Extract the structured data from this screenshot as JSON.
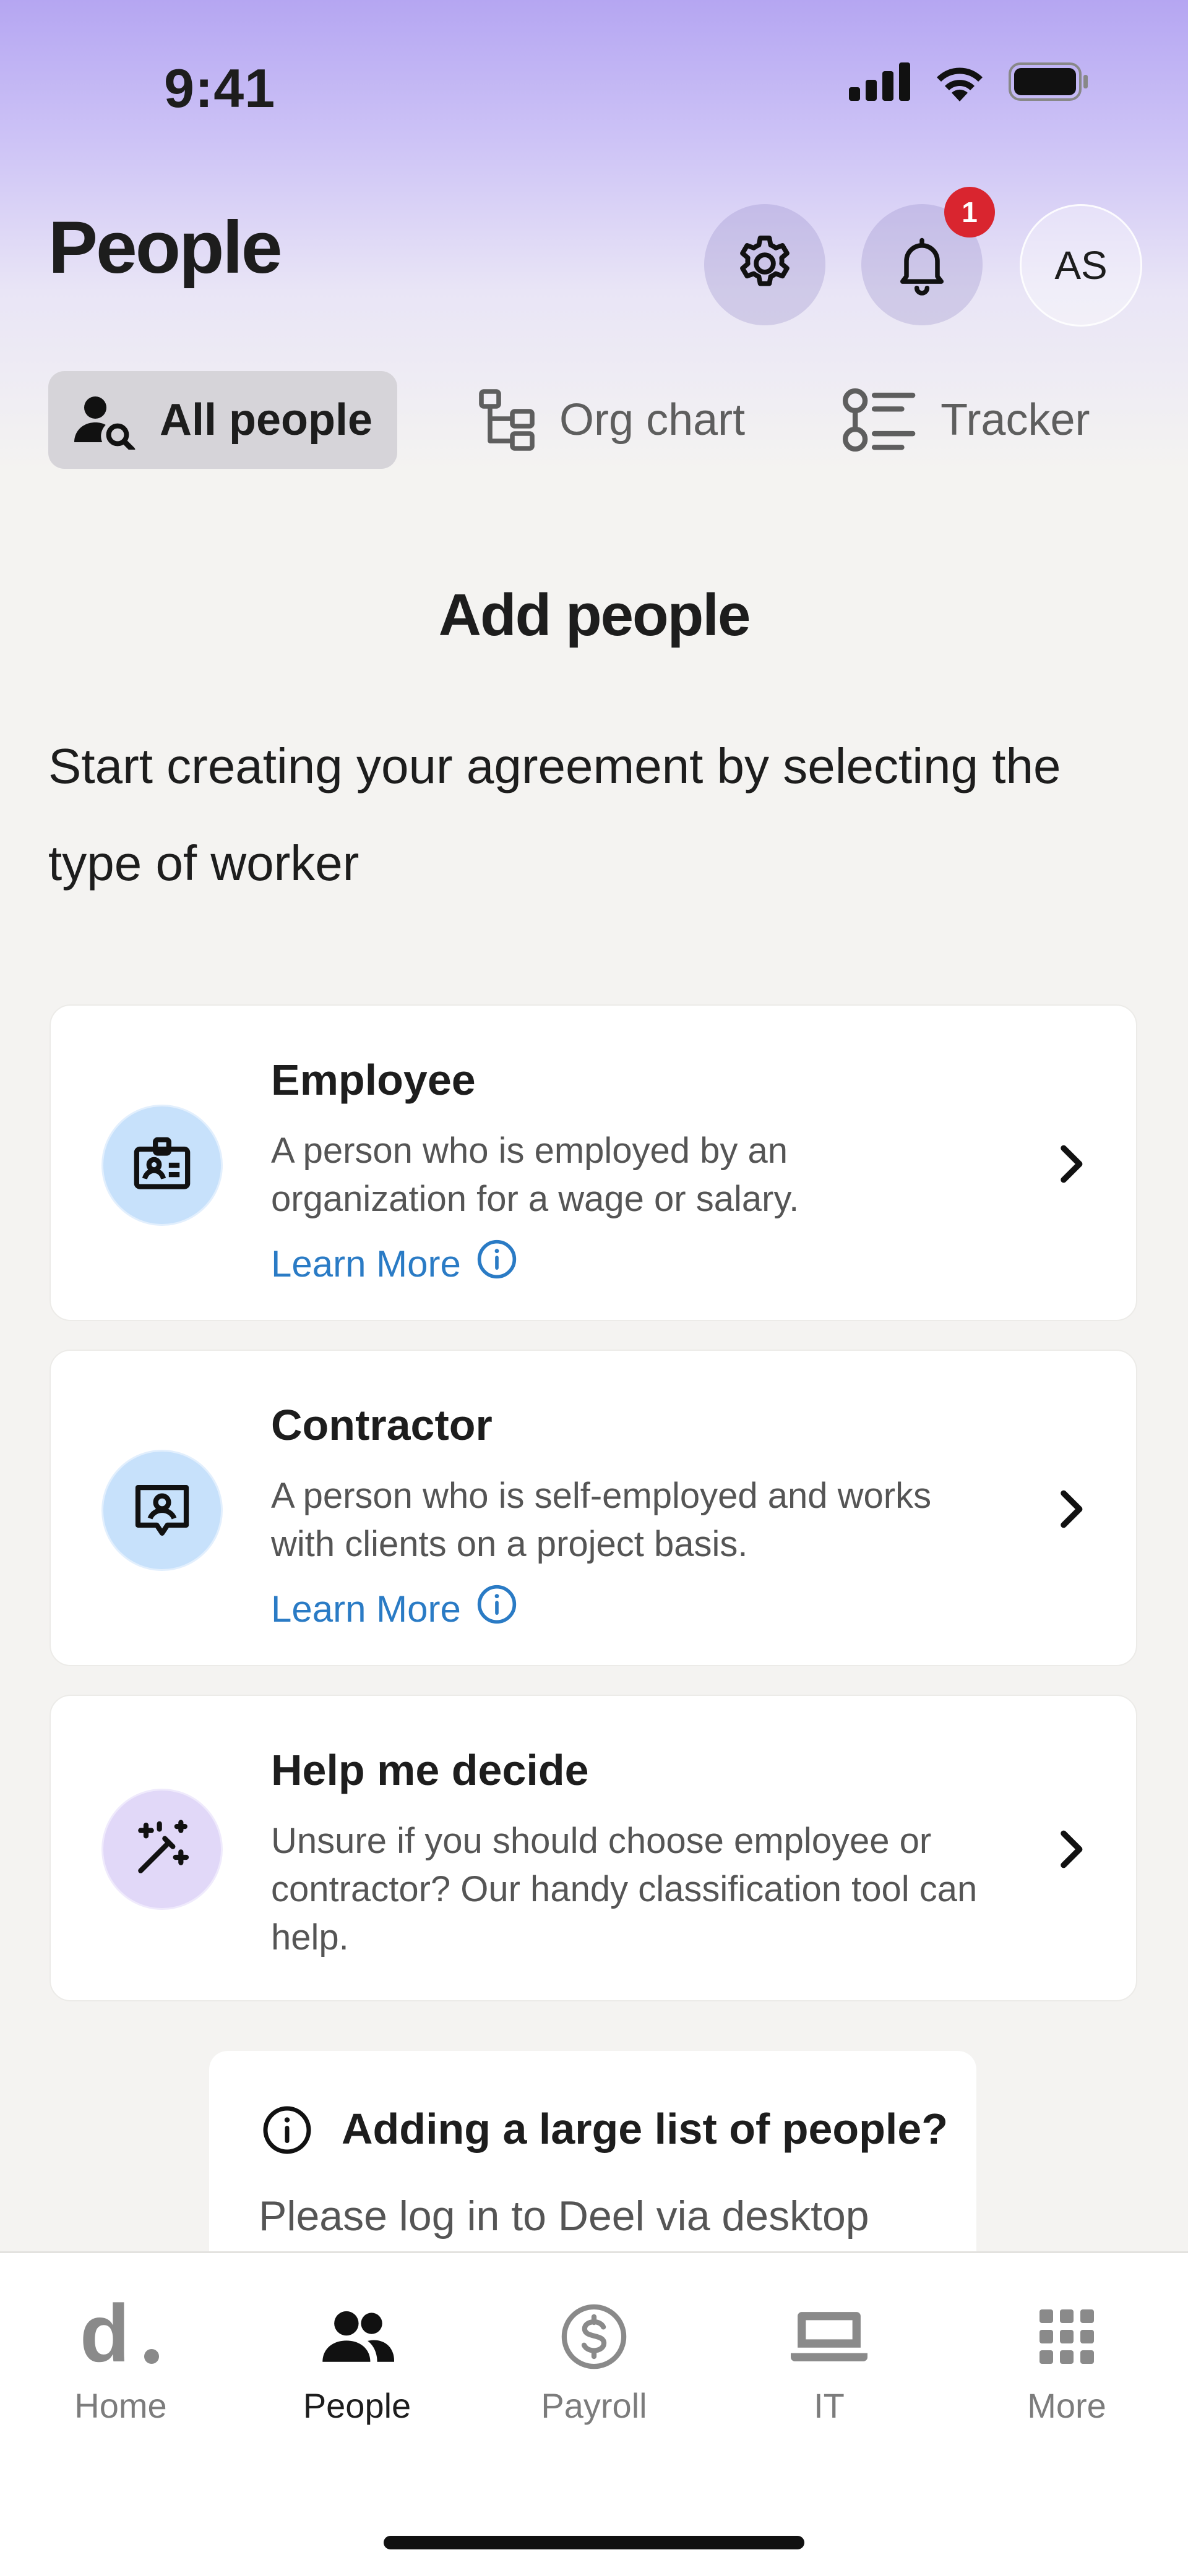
{
  "status_bar": {
    "time": "9:41"
  },
  "header": {
    "title": "People",
    "notification_count": "1",
    "avatar_initials": "AS"
  },
  "tabs": [
    {
      "label": "All people",
      "icon": "person-search-icon",
      "active": true
    },
    {
      "label": "Org chart",
      "icon": "org-chart-icon",
      "active": false
    },
    {
      "label": "Tracker",
      "icon": "tracker-list-icon",
      "active": false
    }
  ],
  "main": {
    "title": "Add people",
    "intro": "Start creating your agreement by selecting the type of worker",
    "cards": [
      {
        "title": "Employee",
        "description": "A person who is employed by an organization for a wage or salary.",
        "link": "Learn More",
        "icon": "id-badge-icon"
      },
      {
        "title": "Contractor",
        "description": "A person who is self-employed and works with clients on a project basis.",
        "link": "Learn More",
        "icon": "contact-card-icon"
      },
      {
        "title": "Help me decide",
        "description": "Unsure if you should choose employee or contractor? Our handy classification tool can help.",
        "icon": "magic-wand-icon"
      }
    ],
    "info": {
      "title": "Adding a large list of people?",
      "body": "Please log in to Deel via desktop"
    }
  },
  "bottom_nav": [
    {
      "label": "Home",
      "icon": "deel-logo-icon",
      "active": false
    },
    {
      "label": "People",
      "icon": "people-icon",
      "active": true
    },
    {
      "label": "Payroll",
      "icon": "dollar-circle-icon",
      "active": false
    },
    {
      "label": "IT",
      "icon": "laptop-icon",
      "active": false
    },
    {
      "label": "More",
      "icon": "grid-icon",
      "active": false
    }
  ],
  "colors": {
    "accent_link": "#2a7bc5",
    "badge": "#d9252f",
    "header_gradient_top": "#b5a6f2",
    "background": "#f4f3f1"
  }
}
